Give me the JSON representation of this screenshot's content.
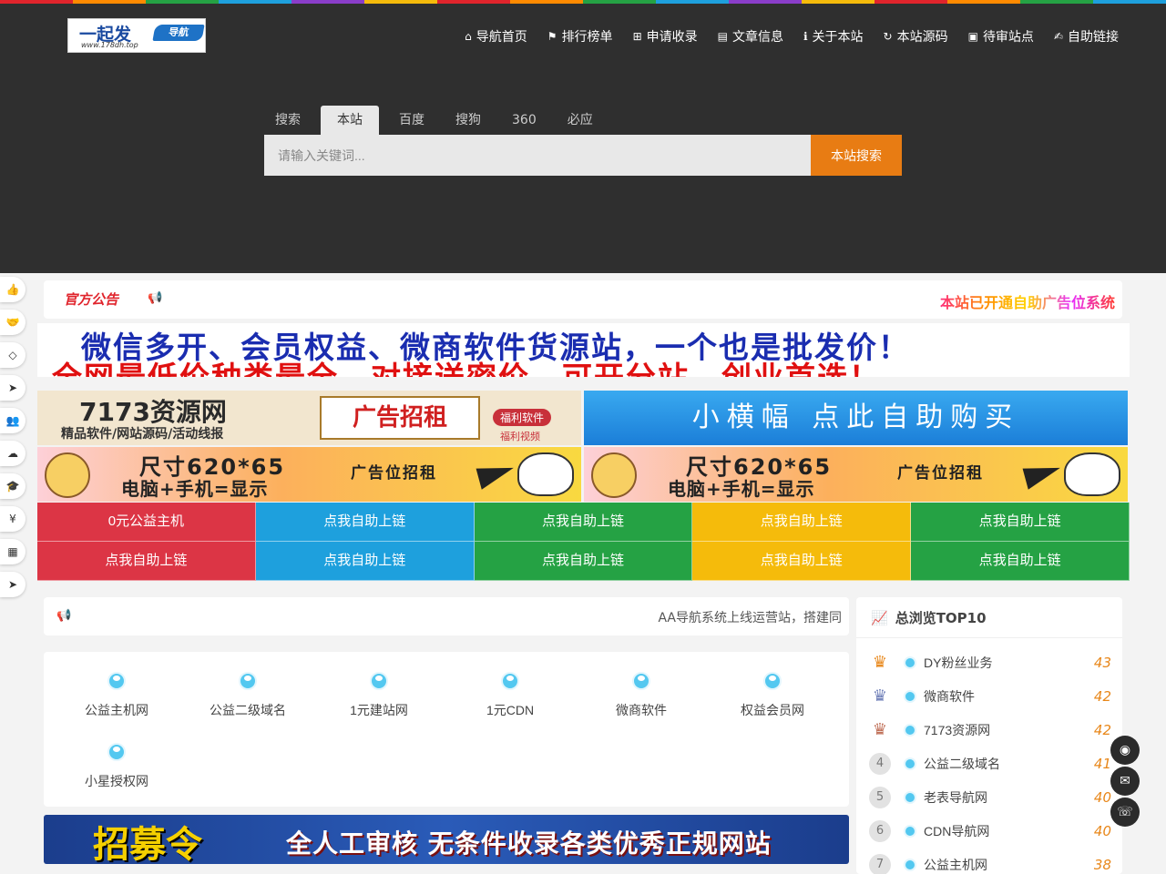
{
  "stripe_colors": [
    "#e0242c",
    "#ff8a00",
    "#25a244",
    "#1ea0dd",
    "#8a3dc9",
    "#f5bb0b",
    "#e0242c",
    "#ff8a00",
    "#25a244",
    "#1ea0dd",
    "#8a3dc9",
    "#f5bb0b",
    "#e0242c",
    "#ff8a00",
    "#25a244",
    "#1ea0dd"
  ],
  "logo": {
    "main": "一起发",
    "url": "www.178dh.top",
    "tag": "导航"
  },
  "nav": [
    {
      "icon": "home-icon",
      "glyph": "⌂",
      "label": "导航首页"
    },
    {
      "icon": "flag-icon",
      "glyph": "⚑",
      "label": "排行榜单"
    },
    {
      "icon": "plus-square-icon",
      "glyph": "⊞",
      "label": "申请收录"
    },
    {
      "icon": "book-icon",
      "glyph": "▤",
      "label": "文章信息"
    },
    {
      "icon": "info-circle-icon",
      "glyph": "ℹ",
      "label": "关于本站"
    },
    {
      "icon": "refresh-icon",
      "glyph": "↻",
      "label": "本站源码"
    },
    {
      "icon": "user-file-icon",
      "glyph": "▣",
      "label": "待审站点"
    },
    {
      "icon": "handshake-icon",
      "glyph": "✍",
      "label": "自助链接"
    }
  ],
  "search": {
    "tabs": [
      "搜索",
      "本站",
      "百度",
      "搜狗",
      "360",
      "必应"
    ],
    "active_tab": 1,
    "placeholder": "请输入关键词...",
    "button": "本站搜索"
  },
  "sidebar_icons": [
    {
      "name": "thumbs-up-icon",
      "glyph": "👍"
    },
    {
      "name": "handshake-icon",
      "glyph": "🤝"
    },
    {
      "name": "diamond-icon",
      "glyph": "◇"
    },
    {
      "name": "send-icon",
      "glyph": "➤"
    },
    {
      "name": "users-icon",
      "glyph": "👥"
    },
    {
      "name": "cloud-icon",
      "glyph": "☁"
    },
    {
      "name": "graduation-cap-icon",
      "glyph": "🎓"
    },
    {
      "name": "yen-icon",
      "glyph": "¥"
    },
    {
      "name": "grid-icon",
      "glyph": "▦"
    },
    {
      "name": "send-icon",
      "glyph": "➤"
    }
  ],
  "announcement": {
    "badge": "官方公告",
    "marquee": "本站已开通自助广告位系统"
  },
  "banner_main": {
    "line1": "微信多开、会员权益、微商软件货源站，一个也是批发价！",
    "line2": "全网最低价种类最全，对接送密价，可开分站，创业首选！"
  },
  "ads": {
    "a": {
      "big": "7173资源网",
      "small": "精品软件/网站源码/活动线报",
      "frame": "广告招租",
      "tag1": "福利软件",
      "tag2": "福利视频"
    },
    "b": {
      "text": "小横幅  点此自助购买"
    },
    "c": {
      "s1": "尺寸620*65",
      "s2": "电脑+手机=显示",
      "s3": "广告位招租"
    },
    "d": {
      "s1": "尺寸620*65",
      "s2": "电脑+手机=显示",
      "s3": "广告位招租"
    }
  },
  "link_cells": [
    {
      "label": "0元公益主机",
      "color": "red"
    },
    {
      "label": "点我自助上链",
      "color": "blue"
    },
    {
      "label": "点我自助上链",
      "color": "green"
    },
    {
      "label": "点我自助上链",
      "color": "yellow"
    },
    {
      "label": "点我自助上链",
      "color": "green"
    },
    {
      "label": "点我自助上链",
      "color": "red"
    },
    {
      "label": "点我自助上链",
      "color": "blue"
    },
    {
      "label": "点我自助上链",
      "color": "green"
    },
    {
      "label": "点我自助上链",
      "color": "yellow"
    },
    {
      "label": "点我自助上链",
      "color": "green"
    }
  ],
  "notice2": {
    "text": "AA导航系统上线运营站，搭建同"
  },
  "sites": [
    "公益主机网",
    "公益二级域名",
    "1元建站网",
    "1元CDN",
    "微商软件",
    "权益会员网",
    "小星授权网"
  ],
  "recruit": {
    "big": "招募令",
    "sub": "全人工审核  无条件收录各类优秀正规网站"
  },
  "top10": {
    "title": "总浏览TOP10",
    "items": [
      {
        "rank": "1",
        "name": "DY粉丝业务",
        "count": "43",
        "medal": "gold"
      },
      {
        "rank": "2",
        "name": "微商软件",
        "count": "42",
        "medal": "silver"
      },
      {
        "rank": "3",
        "name": "7173资源网",
        "count": "42",
        "medal": "bronze"
      },
      {
        "rank": "4",
        "name": "公益二级域名",
        "count": "41"
      },
      {
        "rank": "5",
        "name": "老表导航网",
        "count": "40"
      },
      {
        "rank": "6",
        "name": "CDN导航网",
        "count": "40"
      },
      {
        "rank": "7",
        "name": "公益主机网",
        "count": "38"
      }
    ]
  },
  "float_buttons": [
    {
      "name": "qq-icon",
      "glyph": "◉"
    },
    {
      "name": "envelope-icon",
      "glyph": "✉"
    },
    {
      "name": "wechat-icon",
      "glyph": "☏"
    }
  ]
}
